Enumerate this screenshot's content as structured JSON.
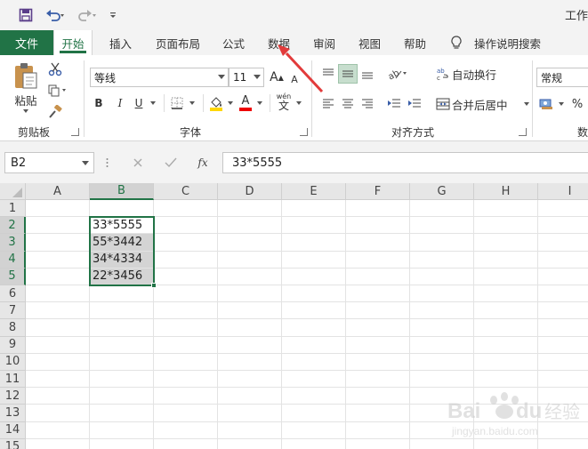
{
  "title_bar": {
    "doc_title": "工作"
  },
  "tabs": [
    "文件",
    "开始",
    "插入",
    "页面布局",
    "公式",
    "数据",
    "审阅",
    "视图",
    "帮助",
    "操作说明搜索"
  ],
  "ribbon": {
    "paste_label": "粘贴",
    "font_name": "等线",
    "font_size": "11",
    "wrap_text": "自动换行",
    "merge_center": "合并后居中",
    "number_format": "常规",
    "percent": "%",
    "groups": {
      "clipboard": "剪贴板",
      "font": "字体",
      "alignment": "对齐方式",
      "number": "数"
    },
    "bold": "B",
    "italic": "I",
    "underline": "U",
    "grow": "A",
    "shrink": "A",
    "font_color": "A",
    "wen": "wén",
    "wen_char": "文"
  },
  "formula_bar": {
    "name_box": "B2",
    "fx": "fx",
    "formula": "33*5555"
  },
  "sheet": {
    "columns": [
      "A",
      "B",
      "C",
      "D",
      "E",
      "F",
      "G",
      "H",
      "I"
    ],
    "rows": [
      "1",
      "2",
      "3",
      "4",
      "5",
      "6",
      "7",
      "8",
      "9",
      "10",
      "11",
      "12",
      "13",
      "14",
      "15"
    ],
    "selected_column": "B",
    "selected_rows": [
      "2",
      "3",
      "4",
      "5"
    ],
    "cells": {
      "B2": "33*5555",
      "B3": "55*3442",
      "B4": "34*4334",
      "B5": "22*3456"
    }
  },
  "colors": {
    "accent": "#217346",
    "arrow": "#e23b3b"
  },
  "watermark": {
    "brand": "Baidu经验",
    "url": "jingyan.baidu.com"
  }
}
